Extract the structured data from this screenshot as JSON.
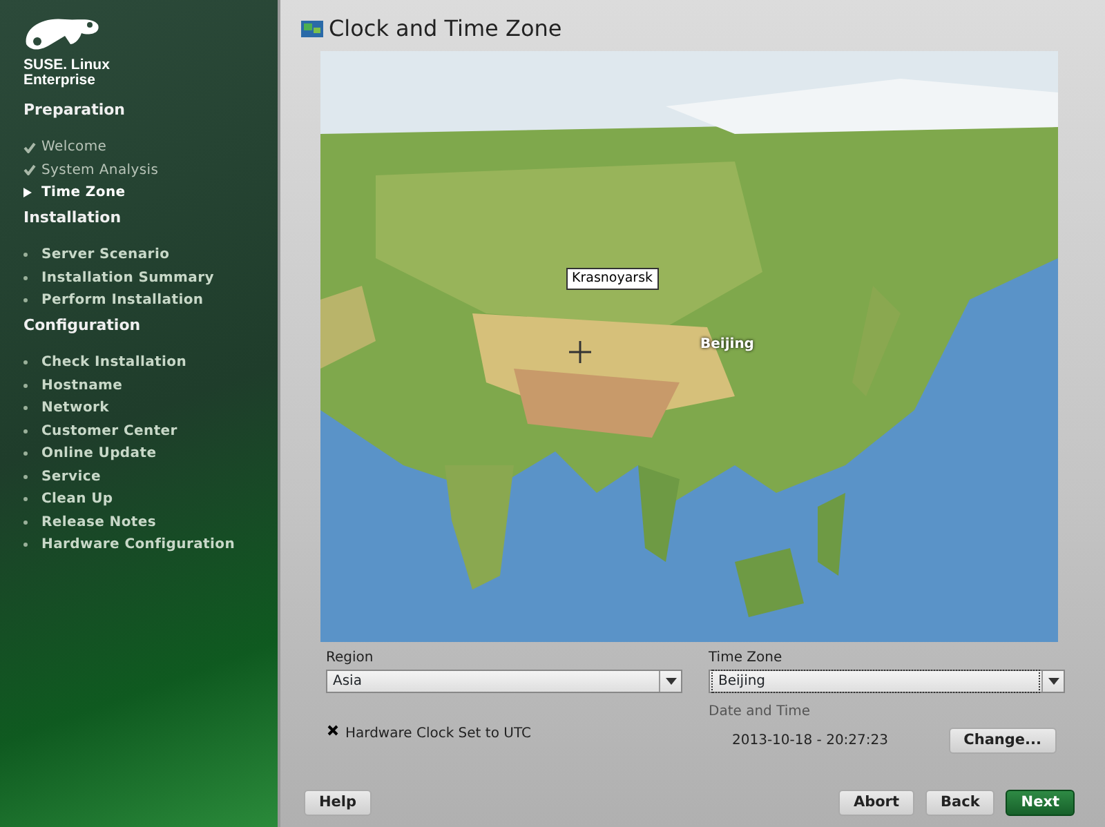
{
  "sidebar": {
    "brand": [
      "SUSE. Linux",
      "Enterprise"
    ],
    "sections": [
      {
        "title": "Preparation",
        "items": [
          {
            "label": "Welcome",
            "kind": "done"
          },
          {
            "label": "System Analysis",
            "kind": "done"
          },
          {
            "label": "Time Zone",
            "kind": "current"
          }
        ]
      },
      {
        "title": "Installation",
        "items": [
          {
            "label": "Server Scenario",
            "kind": "pending"
          },
          {
            "label": "Installation Summary",
            "kind": "pending"
          },
          {
            "label": "Perform Installation",
            "kind": "pending"
          }
        ]
      },
      {
        "title": "Configuration",
        "items": [
          {
            "label": "Check Installation",
            "kind": "pending"
          },
          {
            "label": "Hostname",
            "kind": "pending"
          },
          {
            "label": "Network",
            "kind": "pending"
          },
          {
            "label": "Customer Center",
            "kind": "pending"
          },
          {
            "label": "Online Update",
            "kind": "pending"
          },
          {
            "label": "Service",
            "kind": "pending"
          },
          {
            "label": "Clean Up",
            "kind": "pending"
          },
          {
            "label": "Release Notes",
            "kind": "pending"
          },
          {
            "label": "Hardware Configuration",
            "kind": "pending"
          }
        ]
      }
    ]
  },
  "title": "Clock and Time Zone",
  "map": {
    "tooltip": "Krasnoyarsk",
    "city_label": "Beijing"
  },
  "region": {
    "label": "Region",
    "value": "Asia"
  },
  "time_zone": {
    "label": "Time Zone",
    "value": "Beijing"
  },
  "hardware_clock": {
    "label": "Hardware Clock Set to UTC",
    "checked": true
  },
  "date_and_time": {
    "label": "Date and Time",
    "value": "2013-10-18 - 20:27:23",
    "button": "Change..."
  },
  "buttons": [
    {
      "label": "Help",
      "kind": "plain"
    },
    {
      "label": "Abort",
      "kind": "plain"
    },
    {
      "label": "Back",
      "kind": "plain"
    },
    {
      "label": "Next",
      "kind": "primary"
    }
  ]
}
